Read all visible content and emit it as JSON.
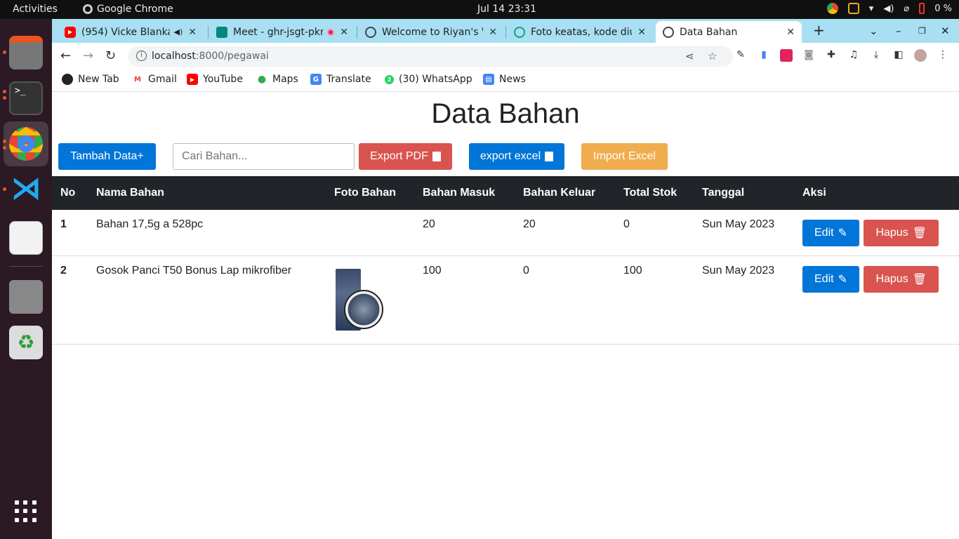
{
  "system": {
    "activities": "Activities",
    "app_name": "Google Chrome",
    "clock": "Jul 14  23:31",
    "battery": "0 %"
  },
  "tabs": [
    {
      "label": "(954) Vicke Blanka",
      "active": false
    },
    {
      "label": "Meet - ghr-jsgt-pkr",
      "active": false
    },
    {
      "label": "Welcome to Riyan's W",
      "active": false
    },
    {
      "label": "Foto keatas, kode diu",
      "active": false
    },
    {
      "label": "Data Bahan",
      "active": true
    }
  ],
  "address_bar": {
    "host": "localhost",
    "path": ":8000/pegawai"
  },
  "bookmarks": [
    {
      "label": "New Tab",
      "icon": "globe-icon"
    },
    {
      "label": "Gmail",
      "icon": "gmail-icon",
      "color": "#ea4335"
    },
    {
      "label": "YouTube",
      "icon": "youtube-icon",
      "color": "#ff0000"
    },
    {
      "label": "Maps",
      "icon": "maps-icon",
      "color": "#34a853"
    },
    {
      "label": "Translate",
      "icon": "translate-icon",
      "color": "#4285f4"
    },
    {
      "label": "(30) WhatsApp",
      "icon": "whatsapp-icon",
      "color": "#25d366"
    },
    {
      "label": "News",
      "icon": "news-icon",
      "color": "#4285f4"
    }
  ],
  "page": {
    "title": "Data Bahan",
    "add_button": "Tambah Data+",
    "search_placeholder": "Cari Bahan...",
    "export_pdf": "Export PDF",
    "export_excel": "export excel",
    "import_excel": "Import Excel",
    "table": {
      "headers": [
        "No",
        "Nama Bahan",
        "Foto Bahan",
        "Bahan Masuk",
        "Bahan Keluar",
        "Total Stok",
        "Tanggal",
        "Aksi"
      ],
      "rows": [
        {
          "no": "1",
          "nama": "Bahan 17,5g a 528pc",
          "has_photo": false,
          "masuk": "20",
          "keluar": "20",
          "stok": "0",
          "tanggal": "Sun May 2023"
        },
        {
          "no": "2",
          "nama": "Gosok Panci T50 Bonus Lap mikrofiber",
          "has_photo": true,
          "masuk": "100",
          "keluar": "0",
          "stok": "100",
          "tanggal": "Sun May 2023"
        }
      ],
      "edit_label": "Edit",
      "delete_label": "Hapus"
    }
  },
  "colors": {
    "primary": "#0275d8",
    "danger": "#d9534f",
    "warning": "#f0ad4e",
    "table_header": "#212529",
    "tabstrip": "#a8dff3"
  }
}
